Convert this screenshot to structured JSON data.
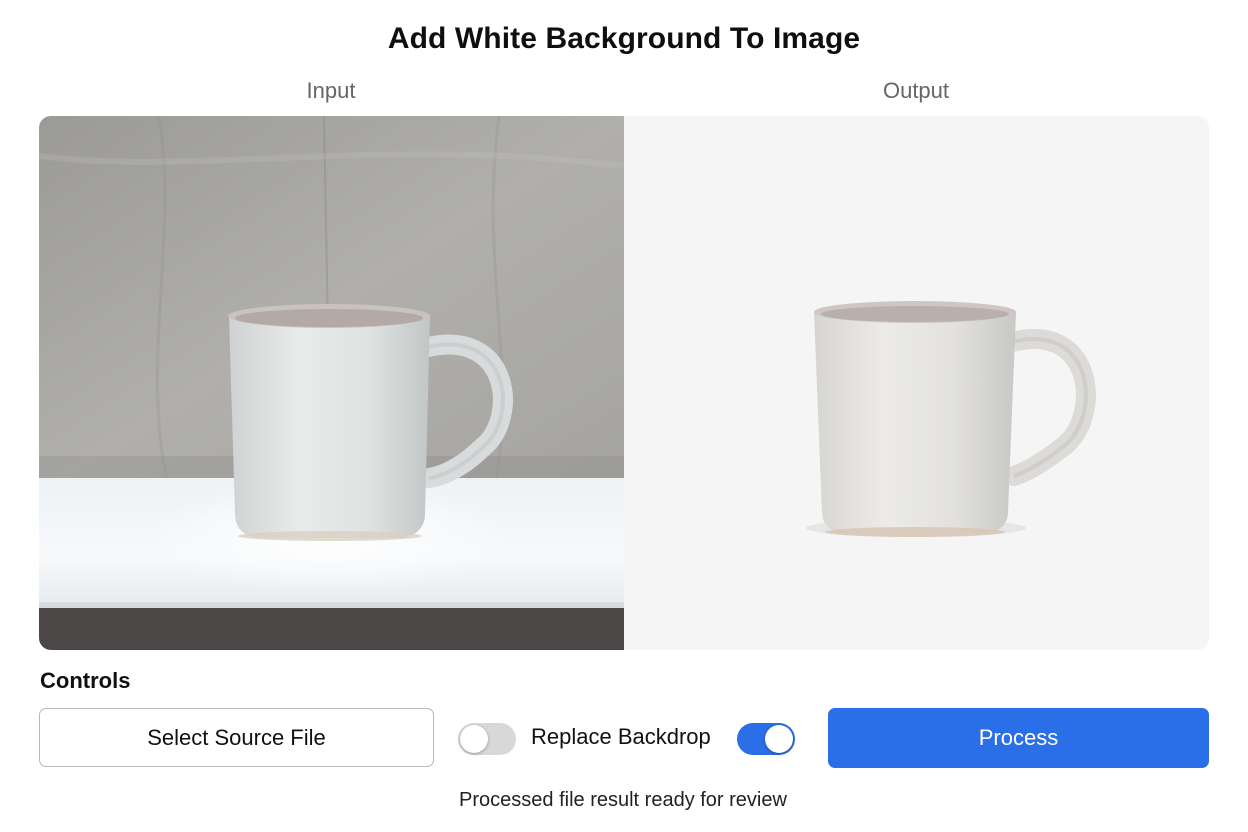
{
  "header": {
    "title": "Add White Background To Image"
  },
  "panels": {
    "input_label": "Input",
    "output_label": "Output"
  },
  "controls": {
    "heading": "Controls",
    "select_button_label": "Select Source File",
    "toggle_left_state": "off",
    "toggle_label": "Replace Backdrop",
    "toggle_right_state": "on",
    "process_button_label": "Process"
  },
  "status": {
    "message": "Processed file result ready for review"
  },
  "colors": {
    "accent": "#2a6fe8",
    "output_background": "#f5f5f5"
  },
  "icons": {
    "input_image": "mug-photo-gray-backdrop",
    "output_image": "mug-photo-white-background"
  }
}
